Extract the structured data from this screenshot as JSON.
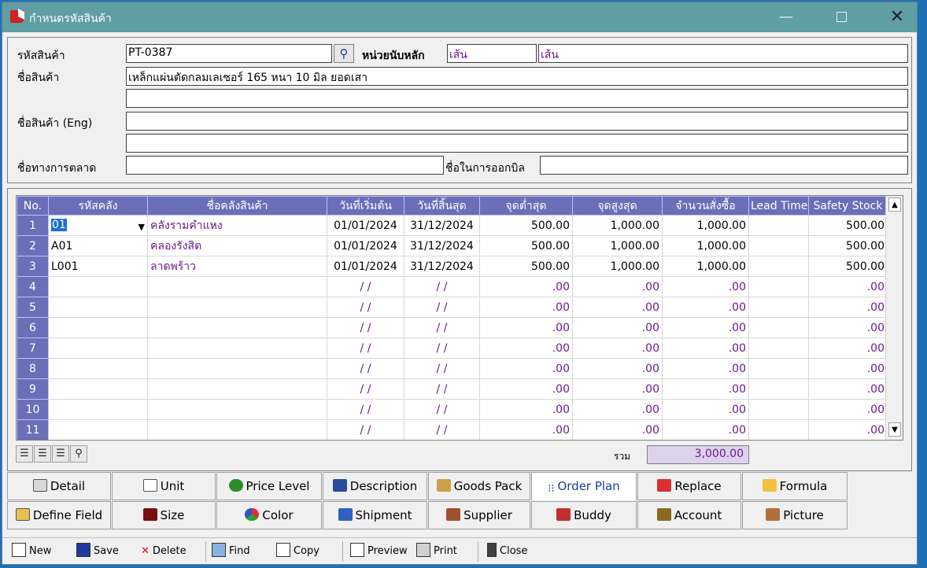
{
  "window": {
    "title": "กำหนดรหัสสินค้า",
    "minimize": "—",
    "close": "✕"
  },
  "header": {
    "code_label": "รหัสสินค้า",
    "code_value": "PT-0387",
    "unit_label": "หน่วยนับหลัก",
    "unit_value": "เส้น",
    "unit_value2": "เส้น",
    "name_label": "ชื่อสินค้า",
    "name_value": "เหล็กแผ่นตัดกลมเลเซอร์ 165 หนา 10 มิล ยอดเสา",
    "name_value2": "",
    "name_eng_label": "ชื่อสินค้า (Eng)",
    "name_eng_value": "",
    "name_eng_value2": "",
    "market_label": "ชื่อทางการตลาด",
    "market_value": "",
    "bill_label": "ชื่อในการออกบิล",
    "bill_value": ""
  },
  "grid": {
    "columns": [
      "No.",
      "รหัสคลัง",
      "ชื่อคลังสินค้า",
      "วันที่เริ่มต้น",
      "วันที่สิ้นสุด",
      "จุดต่ำสุด",
      "จุดสูงสุด",
      "จำนวนสั่งซื้อ",
      "Lead Time",
      "Safety Stock"
    ],
    "rows": [
      [
        "1",
        "01",
        "คลังรามคำแหง",
        "01/01/2024",
        "31/12/2024",
        "500.00",
        "1,000.00",
        "1,000.00",
        "",
        "500.00"
      ],
      [
        "2",
        "A01",
        "คลองรังสิต",
        "01/01/2024",
        "31/12/2024",
        "500.00",
        "1,000.00",
        "1,000.00",
        "",
        "500.00"
      ],
      [
        "3",
        "L001",
        "ลาดพร้าว",
        "01/01/2024",
        "31/12/2024",
        "500.00",
        "1,000.00",
        "1,000.00",
        "",
        "500.00"
      ],
      [
        "4",
        "",
        "",
        "/ /",
        "/ /",
        ".00",
        ".00",
        ".00",
        "",
        ".00"
      ],
      [
        "5",
        "",
        "",
        "/ /",
        "/ /",
        ".00",
        ".00",
        ".00",
        "",
        ".00"
      ],
      [
        "6",
        "",
        "",
        "/ /",
        "/ /",
        ".00",
        ".00",
        ".00",
        "",
        ".00"
      ],
      [
        "7",
        "",
        "",
        "/ /",
        "/ /",
        ".00",
        ".00",
        ".00",
        "",
        ".00"
      ],
      [
        "8",
        "",
        "",
        "/ /",
        "/ /",
        ".00",
        ".00",
        ".00",
        "",
        ".00"
      ],
      [
        "9",
        "",
        "",
        "/ /",
        "/ /",
        ".00",
        ".00",
        ".00",
        "",
        ".00"
      ],
      [
        "10",
        "",
        "",
        "/ /",
        "/ /",
        ".00",
        ".00",
        ".00",
        "",
        ".00"
      ],
      [
        "11",
        "",
        "",
        "/ /",
        "/ /",
        ".00",
        ".00",
        ".00",
        "",
        ".00"
      ]
    ],
    "total_label": "รวม",
    "total_value": "3,000.00"
  },
  "tabs_row1": [
    "Detail",
    "Unit",
    "Price Level",
    "Description",
    "Goods Pack",
    "Order Plan",
    "Replace",
    "Formula"
  ],
  "tabs_row2": [
    "Define Field",
    "Size",
    "Color",
    "Shipment",
    "Supplier",
    "Buddy",
    "Account",
    "Picture"
  ],
  "active_tab": "Order Plan",
  "toolbar": {
    "new": "New",
    "save": "Save",
    "delete": "Delete",
    "find": "Find",
    "copy": "Copy",
    "preview": "Preview",
    "print": "Print",
    "close": "Close"
  },
  "colors": {
    "titlebar": "#5f9ea3",
    "grid_header": "#6a6fb8",
    "accent_purple": "#6a1a8a",
    "selection": "#1e6fd9"
  }
}
